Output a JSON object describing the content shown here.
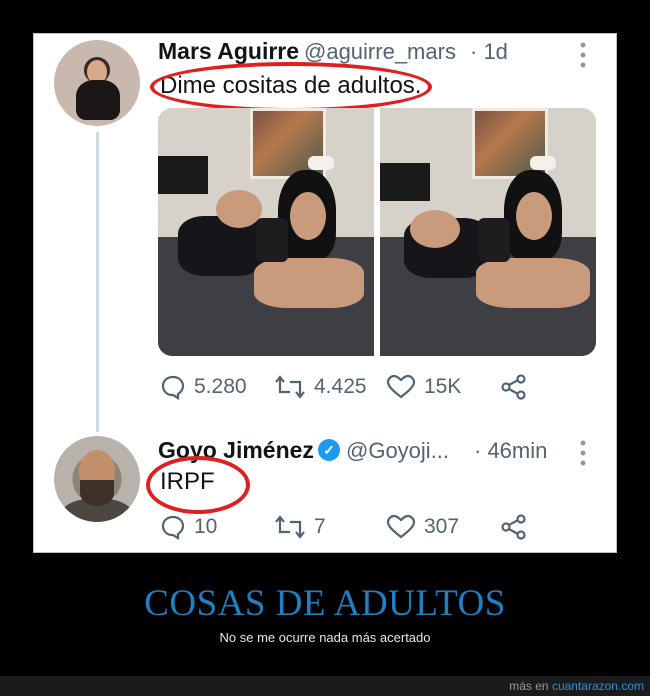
{
  "tweet1": {
    "name": "Mars Aguirre",
    "handle": "@aguirre_mars",
    "time": "· 1d",
    "text": "Dime cositas de adultos.",
    "replies": "5.280",
    "retweets": "4.425",
    "likes": "15K"
  },
  "tweet2": {
    "name": "Goyo Jiménez",
    "handle": "@Goyoji...",
    "time": "· 46min",
    "text": "IRPF",
    "replies": "10",
    "retweets": "7",
    "likes": "307"
  },
  "caption": {
    "title": "COSAS DE ADULTOS",
    "subtitle": "No se me ocurre nada más acertado"
  },
  "footer": {
    "prefix": "más en",
    "site": "cuantarazon.com"
  },
  "colors": {
    "accent": "#1e7fc2",
    "annotation": "#e02020",
    "verified": "#1d9bf0"
  },
  "icons": [
    "reply-icon",
    "retweet-icon",
    "like-icon",
    "share-icon",
    "more-icon",
    "verified-icon"
  ]
}
